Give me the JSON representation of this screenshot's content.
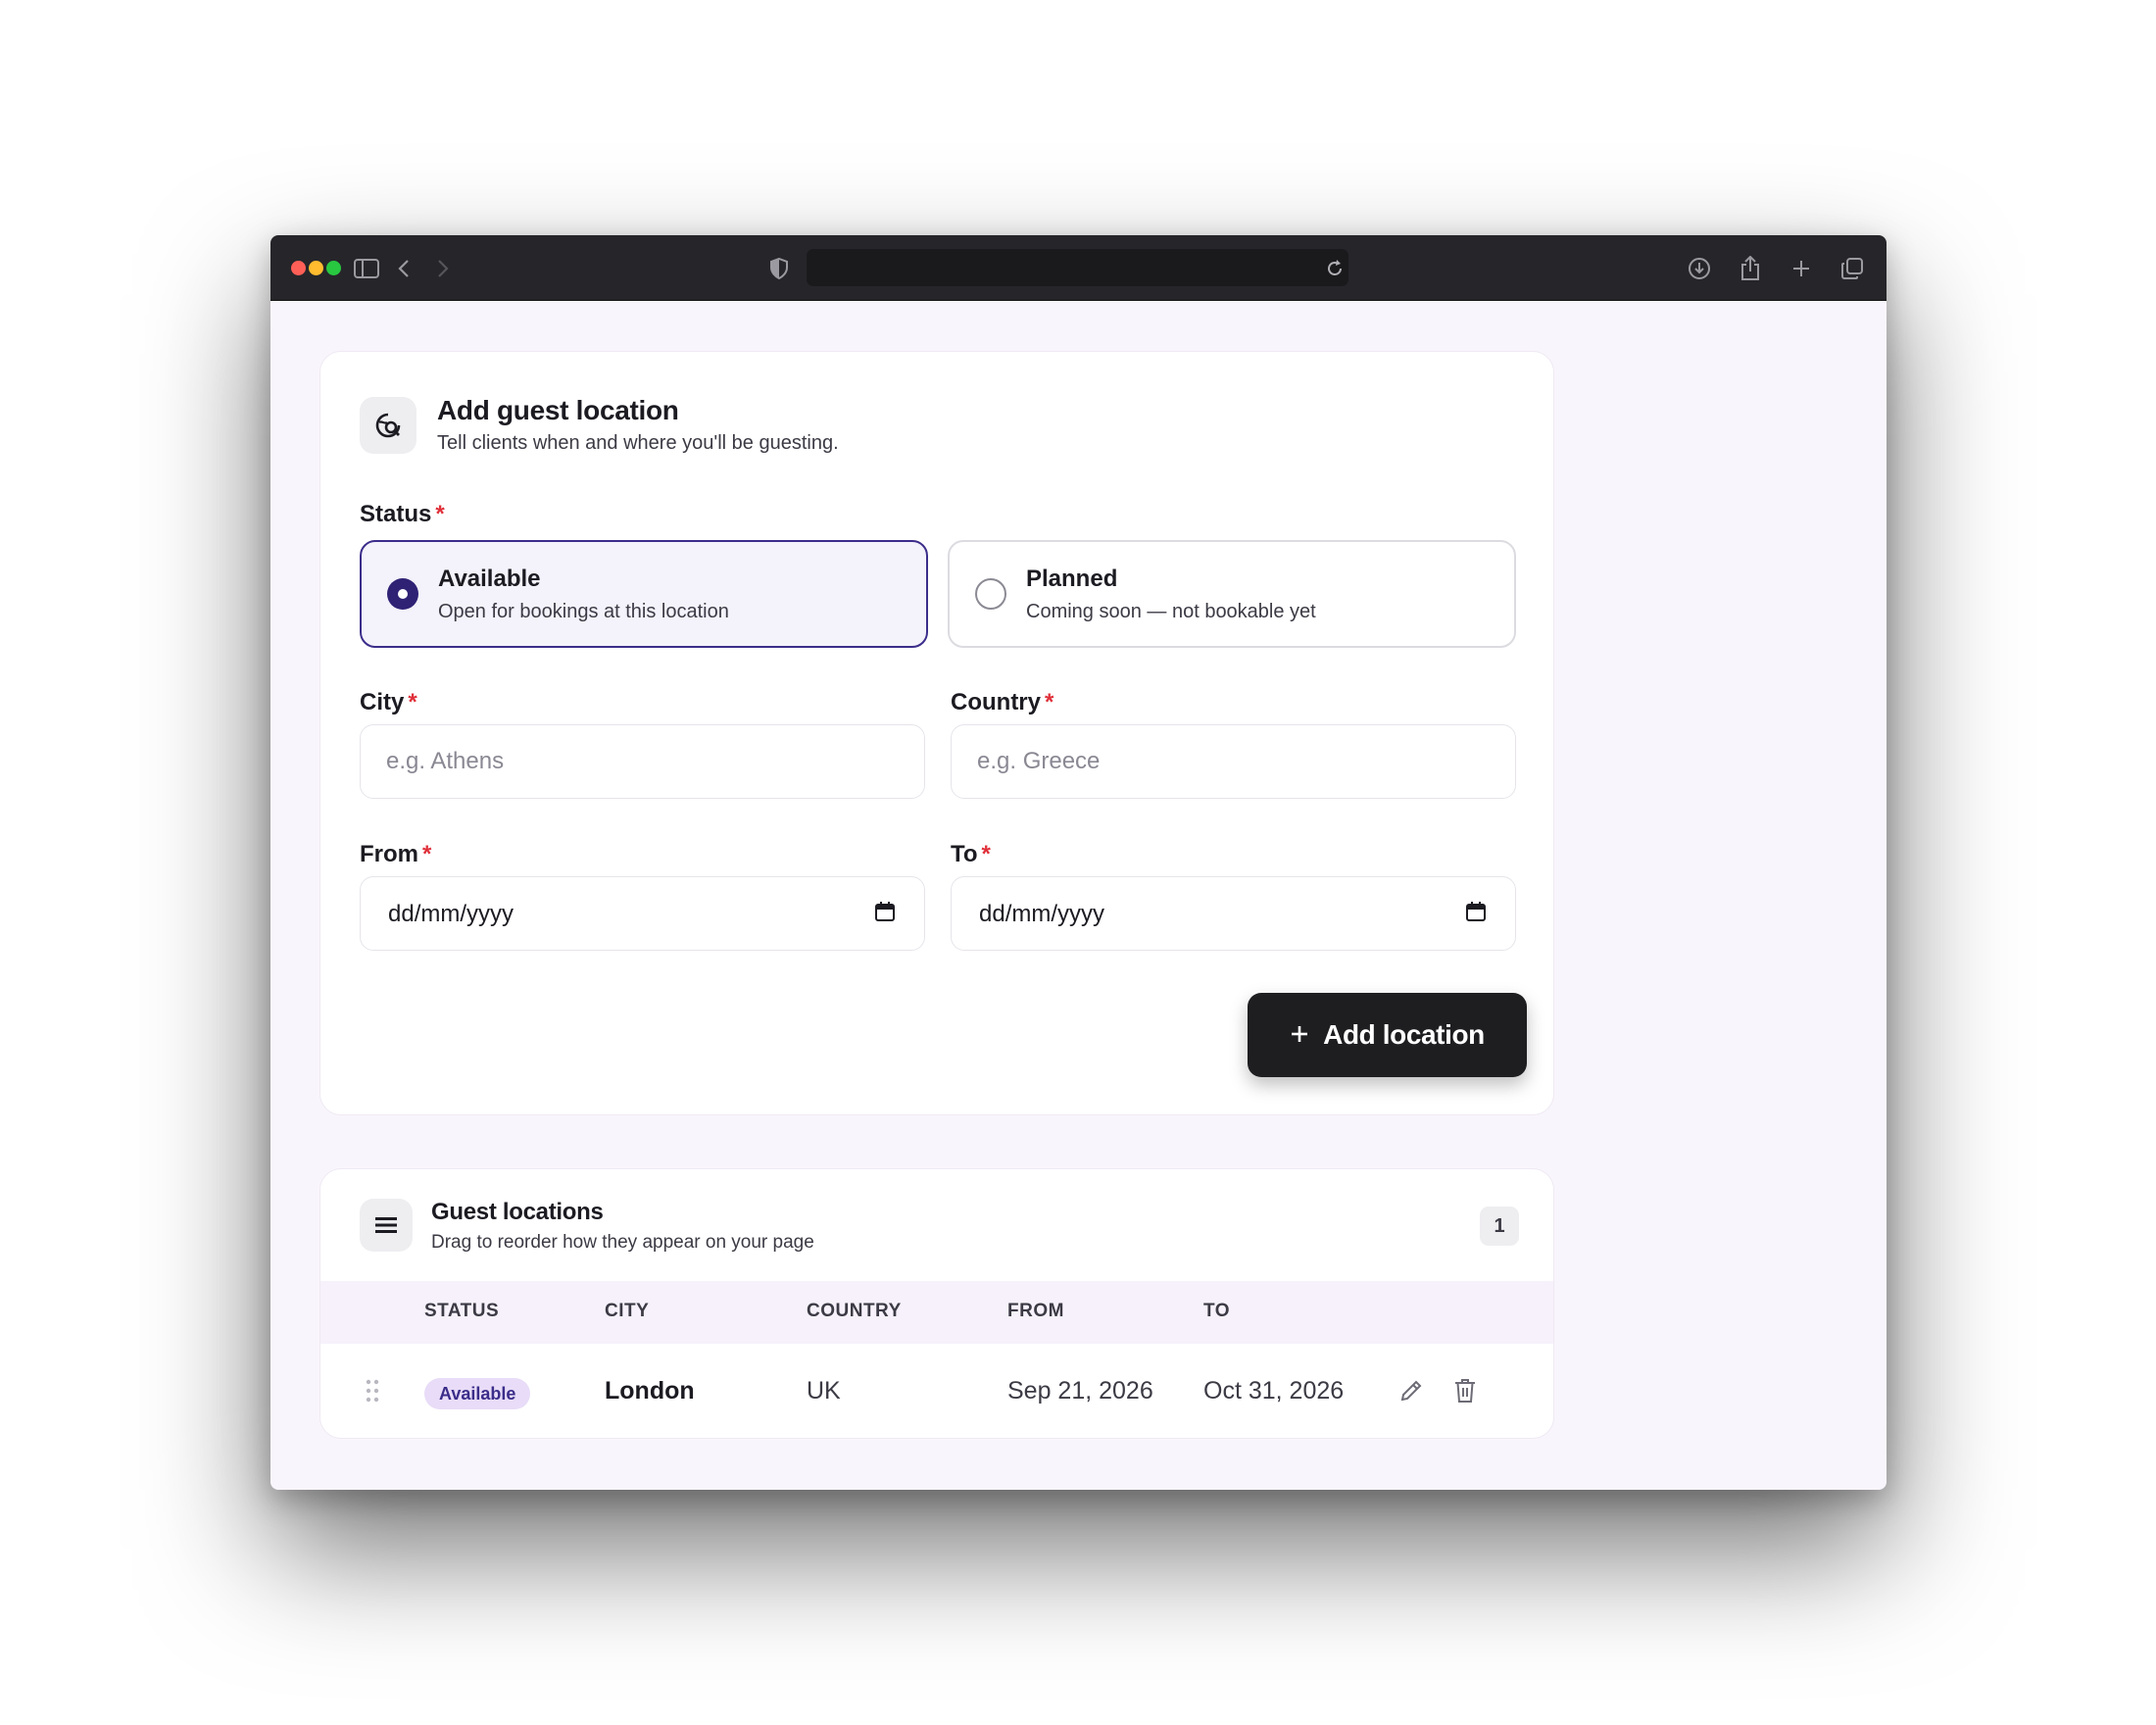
{
  "form": {
    "title": "Add guest location",
    "subtitle": "Tell clients when and where you'll be guesting.",
    "status_label": "Status",
    "required_mark": "*",
    "status_options": [
      {
        "title": "Available",
        "subtitle": "Open for bookings at this location",
        "selected": true
      },
      {
        "title": "Planned",
        "subtitle": "Coming soon — not bookable yet",
        "selected": false
      }
    ],
    "city_label": "City",
    "city_placeholder": "e.g. Athens",
    "country_label": "Country",
    "country_placeholder": "e.g. Greece",
    "from_label": "From",
    "from_value": "dd/mm/yyyy",
    "to_label": "To",
    "to_value": "dd/mm/yyyy",
    "add_button": "Add location"
  },
  "list": {
    "title": "Guest locations",
    "subtitle": "Drag to reorder how they appear on your page",
    "count": "1",
    "columns": [
      "STATUS",
      "CITY",
      "COUNTRY",
      "FROM",
      "TO"
    ],
    "rows": [
      {
        "status": "Available",
        "city": "London",
        "country": "UK",
        "from": "Sep 21, 2026",
        "to": "Oct 31, 2026"
      }
    ]
  },
  "colors": {
    "accent": "#2f2275",
    "badge_bg": "#e8dcf8",
    "button_dark": "#1e1e21",
    "required": "#e0303a",
    "page_bg": "#f9f5fc"
  },
  "icons": {
    "form_header": "location-search-icon",
    "list_header": "list-icon",
    "drag": "drag-handle-icon",
    "edit": "pencil-icon",
    "delete": "trash-icon",
    "date": "calendar-icon",
    "add": "plus-icon"
  }
}
